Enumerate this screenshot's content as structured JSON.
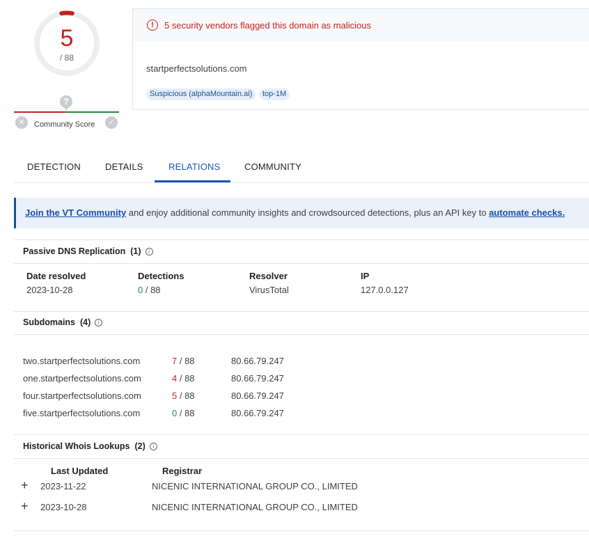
{
  "score": {
    "detections": "5",
    "total": "/ 88",
    "ring_fraction": 0.0568,
    "ring_color": "#c5221f"
  },
  "community": {
    "label": "Community Score"
  },
  "header": {
    "alert": "5 security vendors flagged this domain as malicious",
    "domain": "startperfectsolutions.com",
    "tags": [
      "Suspicious (alphaMountain.ai)",
      "top-1M"
    ]
  },
  "tabs": [
    "DETECTION",
    "DETAILS",
    "RELATIONS",
    "COMMUNITY"
  ],
  "banner": {
    "link1": "Join the VT Community",
    "middle": " and enjoy additional community insights and crowdsourced detections, plus an API key to ",
    "link2": "automate checks."
  },
  "passive_dns": {
    "title": "Passive DNS Replication",
    "count": "(1)",
    "headers": [
      "Date resolved",
      "Detections",
      "Resolver",
      "IP"
    ],
    "rows": [
      {
        "date": "2023-10-28",
        "det": "0",
        "total": " / 88",
        "resolver": "VirusTotal",
        "ip": "127.0.0.127"
      }
    ]
  },
  "subdomains": {
    "title": "Subdomains",
    "count": "(4)",
    "rows": [
      {
        "name": "two.startperfectsolutions.com",
        "det": "7",
        "total": " / 88",
        "ip": "80.66.79.247"
      },
      {
        "name": "one.startperfectsolutions.com",
        "det": "4",
        "total": " / 88",
        "ip": "80.66.79.247"
      },
      {
        "name": "four.startperfectsolutions.com",
        "det": "5",
        "total": " / 88",
        "ip": "80.66.79.247"
      },
      {
        "name": "five.startperfectsolutions.com",
        "det": "0",
        "total": " / 88",
        "ip": "80.66.79.247"
      }
    ]
  },
  "whois": {
    "title": "Historical Whois Lookups",
    "count": "(2)",
    "headers": [
      "Last Updated",
      "Registrar"
    ],
    "rows": [
      {
        "date": "2023-11-22",
        "registrar": "NICENIC INTERNATIONAL GROUP CO., LIMITED"
      },
      {
        "date": "2023-10-28",
        "registrar": "NICENIC INTERNATIONAL GROUP CO., LIMITED"
      }
    ]
  }
}
